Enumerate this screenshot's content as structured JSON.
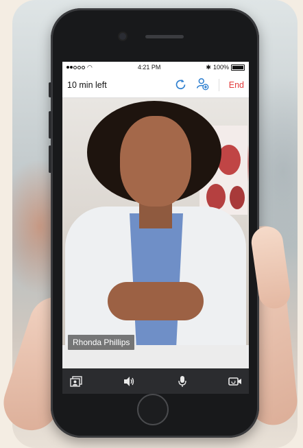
{
  "status_bar": {
    "signal_dots": [
      true,
      true,
      false,
      false,
      false
    ],
    "time": "4:21 PM",
    "battery": "100%"
  },
  "header": {
    "time_left": "10 min left",
    "end_label": "End"
  },
  "video": {
    "participant_name": "Rhonda Phillips"
  },
  "toolbar": {
    "items": [
      "screen-share-icon",
      "speaker-icon",
      "microphone-icon",
      "camera-switch-icon"
    ]
  },
  "colors": {
    "accent": "#2d7fd0",
    "end": "#e33b3b",
    "toolbar_bg": "#2b2c2f"
  }
}
